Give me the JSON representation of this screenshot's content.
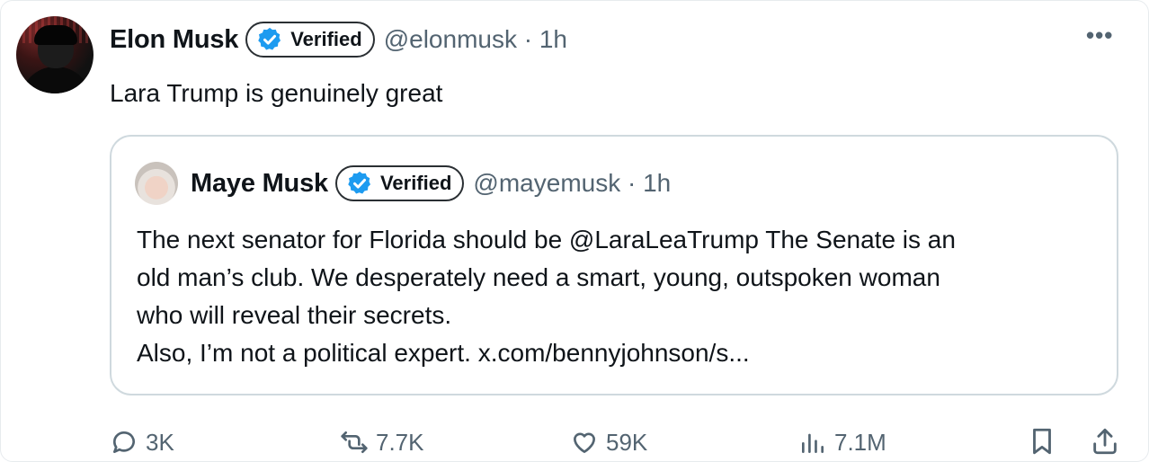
{
  "tweet": {
    "author_name": "Elon Musk",
    "verified_label": "Verified",
    "handle_time": "@elonmusk · 1h",
    "text": "Lara Trump is genuinely great",
    "more_icon": "more-horizontal-icon"
  },
  "quote": {
    "author_name": "Maye Musk",
    "verified_label": "Verified",
    "handle_time": "@mayemusk · 1h",
    "lines": [
      "The next senator for Florida should be @LaraLeaTrump The Senate is an",
      "old man’s club. We desperately need a smart, young, outspoken woman",
      "who will reveal their secrets.",
      "Also, I’m not a political expert. x.com/bennyjohnson/s..."
    ]
  },
  "actions": {
    "replies": "3K",
    "reposts": "7.7K",
    "likes": "59K",
    "views": "7.1M"
  },
  "colors": {
    "verified_blue": "#1d9bf0",
    "secondary_text": "#536471",
    "border": "#cfd9de"
  }
}
